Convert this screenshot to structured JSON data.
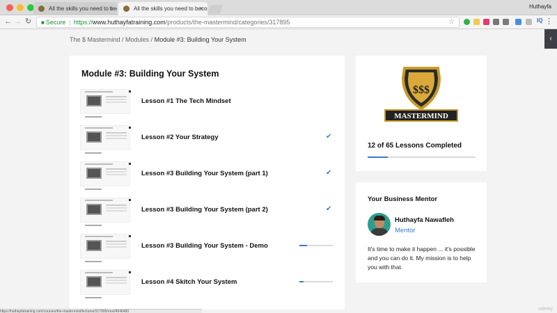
{
  "browser": {
    "tabs": [
      {
        "label": "All the skills you need to becom"
      },
      {
        "label": "All the skills you need to becom"
      }
    ],
    "tab_close": "×",
    "user": "Huthayfa",
    "secure_label": "Secure",
    "url": {
      "scheme": "https://",
      "host": "www.huthayfatraining.com",
      "path": "/products/the-mastermind/categories/317895"
    },
    "status_url": "https://huthayfatraining.com/courses/the-mastermind/lectures/317895/next/4546480"
  },
  "breadcrumb": {
    "items": [
      "The $ Mastermind",
      "Modules"
    ],
    "separator": " / ",
    "current": "Module #3: Building Your System"
  },
  "module": {
    "title": "Module #3: Building Your System",
    "lessons": [
      {
        "title": "Lesson #1 The Tech Mindset",
        "status": "none"
      },
      {
        "title": "Lesson #2 Your Strategy",
        "status": "complete"
      },
      {
        "title": "Lesson #3 Building Your System (part 1)",
        "status": "complete"
      },
      {
        "title": "Lesson #3 Building Your System (part 2)",
        "status": "complete"
      },
      {
        "title": "Lesson #3 Building Your System - Demo",
        "status": "in-progress",
        "progress": 0.22
      },
      {
        "title": "Lesson #4 Skitch Your System",
        "status": "in-progress",
        "progress": 0.12
      }
    ]
  },
  "course_progress": {
    "label": "12 of 65 Lessons Completed",
    "completed": 12,
    "total": 65,
    "logo_text": "MASTERMIND",
    "logo_symbol": "$$$"
  },
  "mentor": {
    "heading": "Your Business Mentor",
    "name": "Huthayfa Nawafleh",
    "role": "Mentor",
    "bio": "It's time to make it happen ... it's possible and you can do it. My mission is to help you with that."
  },
  "watermark": "udemy",
  "colors": {
    "accent": "#3d78c7",
    "secure_green": "#1e8e3e",
    "sidebar_toggle": "#3d3f46"
  }
}
